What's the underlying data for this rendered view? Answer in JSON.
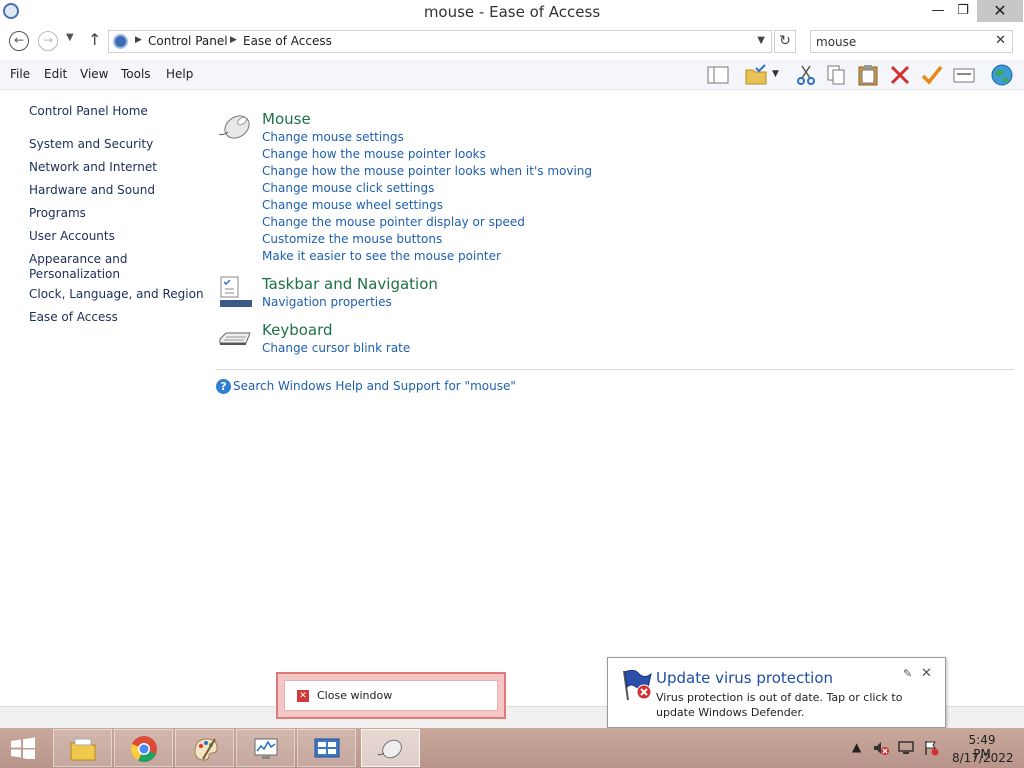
{
  "window": {
    "title": "mouse - Ease of Access",
    "min_glyph": "—",
    "max_glyph": "❐",
    "close_glyph": "✕"
  },
  "address": {
    "breadcrumb": [
      "Control Panel",
      "Ease of Access"
    ],
    "search_value": "mouse"
  },
  "menu": [
    "File",
    "Edit",
    "View",
    "Tools",
    "Help"
  ],
  "toolbar_icons": [
    "pane-icon",
    "folder-check-icon",
    "cut-icon",
    "copy-icon",
    "paste-icon",
    "delete-icon",
    "checkmark-icon",
    "properties-icon",
    "globe-icon"
  ],
  "sidebar": {
    "home": "Control Panel Home",
    "items": [
      "System and Security",
      "Network and Internet",
      "Hardware and Sound",
      "Programs",
      "User Accounts",
      "Appearance and",
      "Personalization",
      "Clock, Language, and Region",
      "Ease of Access"
    ]
  },
  "results": {
    "mouse": {
      "title": "Mouse",
      "links": [
        "Change mouse settings",
        "Change how the mouse pointer looks",
        "Change how the mouse pointer looks when it's moving",
        "Change mouse click settings",
        "Change mouse wheel settings",
        "Change the mouse pointer display or speed",
        "Customize the mouse buttons",
        "Make it easier to see the mouse pointer"
      ]
    },
    "taskbar": {
      "title": "Taskbar and Navigation",
      "links": [
        "Navigation properties"
      ]
    },
    "keyboard": {
      "title": "Keyboard",
      "links": [
        "Change cursor blink rate"
      ]
    },
    "help_link": "Search Windows Help and Support for \"mouse\""
  },
  "close_window": "Close window",
  "notification": {
    "title": "Update virus protection",
    "body": "Virus protection is out of date. Tap or click to update Windows Defender."
  },
  "taskbar_apps": [
    "file-explorer",
    "chrome",
    "paint",
    "performance-monitor",
    "control-panel",
    "mouse"
  ],
  "clock": {
    "time": "5:49 PM",
    "date": "8/17/2022"
  },
  "colors": {
    "link": "#1f5fb0",
    "category_title": "#1e7145",
    "sidebar_link": "#1c2e58",
    "notif_title": "#1f4ea7"
  }
}
